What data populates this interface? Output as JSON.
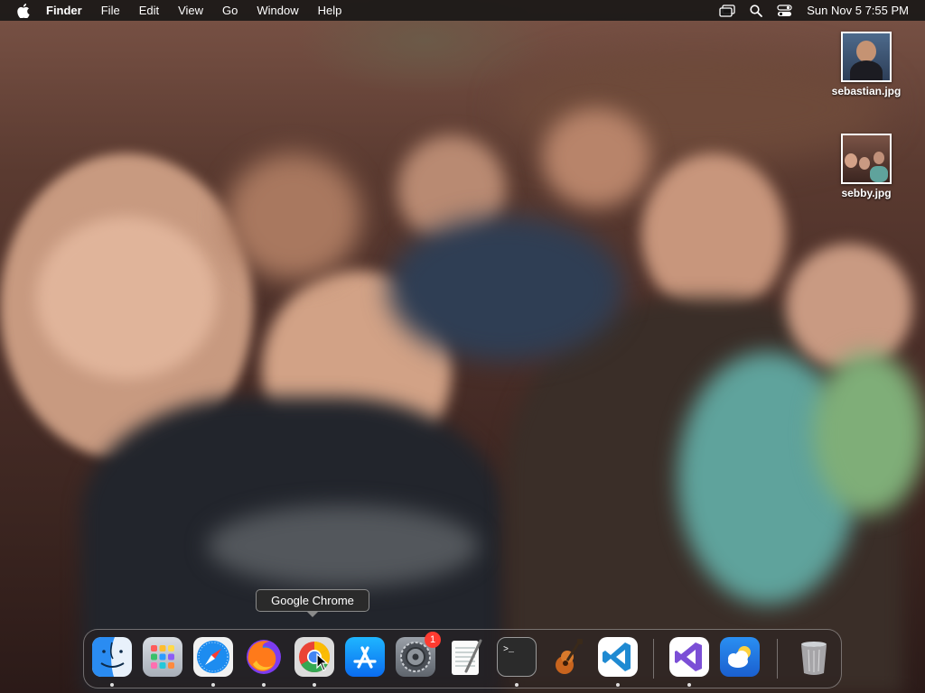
{
  "menubar": {
    "app_name": "Finder",
    "items": [
      "File",
      "Edit",
      "View",
      "Go",
      "Window",
      "Help"
    ],
    "clock": "Sun Nov 5  7:55 PM"
  },
  "desktop": {
    "icons": [
      {
        "label": "sebastian.jpg",
        "icon": "image-file-icon"
      },
      {
        "label": "sebby.jpg",
        "icon": "image-file-icon"
      }
    ]
  },
  "tooltip": {
    "text": "Google Chrome"
  },
  "dock": {
    "items": [
      {
        "name": "Finder",
        "icon": "finder-icon",
        "running": true
      },
      {
        "name": "Launchpad",
        "icon": "launchpad-icon",
        "running": false
      },
      {
        "name": "Safari",
        "icon": "safari-icon",
        "running": true
      },
      {
        "name": "Firefox",
        "icon": "firefox-icon",
        "running": true
      },
      {
        "name": "Google Chrome",
        "icon": "chrome-icon",
        "running": true
      },
      {
        "name": "App Store",
        "icon": "app-store-icon",
        "running": false
      },
      {
        "name": "System Settings",
        "icon": "settings-icon",
        "running": false,
        "badge": "1"
      },
      {
        "name": "TextEdit",
        "icon": "textedit-icon",
        "running": false
      },
      {
        "name": "Terminal",
        "icon": "terminal-icon",
        "running": true
      },
      {
        "name": "GarageBand",
        "icon": "garageband-icon",
        "running": false
      },
      {
        "name": "Visual Studio Code",
        "icon": "vscode-icon",
        "running": true
      },
      {
        "name": "Visual Studio",
        "icon": "visual-studio-icon",
        "running": true
      },
      {
        "name": "Weather",
        "icon": "weather-icon",
        "running": false
      },
      {
        "name": "Trash",
        "icon": "trash-icon",
        "running": false
      }
    ]
  },
  "colors": {
    "menubar_bg": "#141414",
    "badge": "#ff3b30",
    "tooltip_bg": "#2a2a2a"
  }
}
